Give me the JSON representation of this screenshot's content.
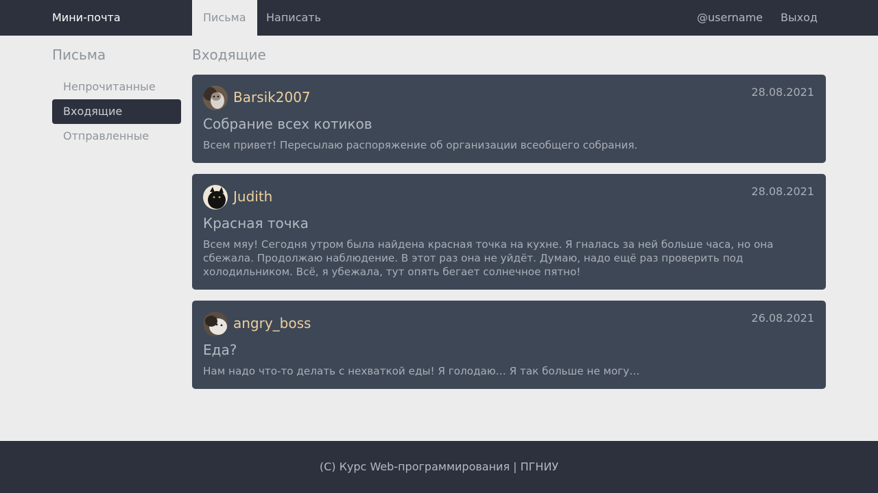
{
  "header": {
    "brand": "Мини-почта",
    "tabs": [
      {
        "label": "Письма"
      },
      {
        "label": "Написать"
      }
    ],
    "username": "@username",
    "logout": "Выход"
  },
  "sidebar": {
    "title": "Письма",
    "items": [
      {
        "label": "Непрочитанные"
      },
      {
        "label": "Входящие"
      },
      {
        "label": "Отправленные"
      }
    ]
  },
  "main": {
    "title": "Входящие",
    "messages": [
      {
        "sender": "Barsik2007",
        "date": "28.08.2021",
        "subject": "Собрание всех котиков",
        "preview": "Всем привет! Пересылаю распоряжение об организации всеобщего собрания."
      },
      {
        "sender": "Judith",
        "date": "28.08.2021",
        "subject": "Красная точка",
        "preview": "Всем мяу! Сегодня утром была найдена красная точка на кухне. Я гналась за ней больше часа, но она сбежала. Продолжаю наблюдение. В этот раз она не уйдёт. Думаю, надо ещё раз проверить под холодильником. Всё, я убежала, тут опять бегает солнечное пятно!"
      },
      {
        "sender": "angry_boss",
        "date": "26.08.2021",
        "subject": "Еда?",
        "preview": "Нам надо что-то делать с нехваткой еды! Я голодаю… Я так больше не могу…"
      }
    ]
  },
  "footer": {
    "text": "(C) Курс Web-программирования | ПГНИУ"
  },
  "colors": {
    "nav_bg": "#2c313d",
    "page_bg": "#ececec",
    "card_bg": "#3e4756",
    "sender": "#ecd09c"
  }
}
